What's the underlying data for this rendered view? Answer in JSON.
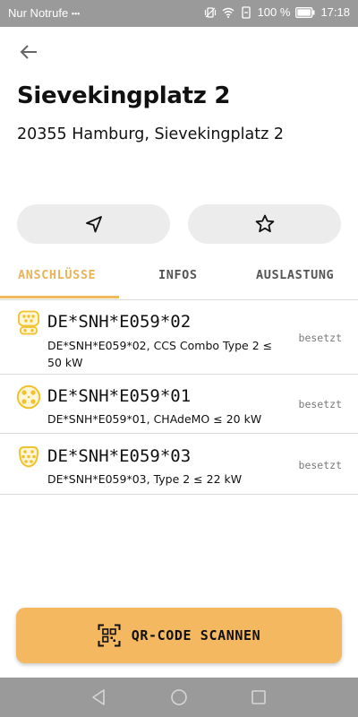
{
  "status_bar": {
    "carrier": "Nur Notrufe",
    "carrier_dots": "•••",
    "battery": "100 %",
    "time": "17:18"
  },
  "header": {
    "title": "Sievekingplatz 2",
    "address": "20355 Hamburg, Sievekingplatz 2"
  },
  "actions": {
    "navigate_icon": "navigation-arrow-icon",
    "favorite_icon": "star-outline-icon"
  },
  "tabs": [
    {
      "label": "ANSCHLÜSSE",
      "active": true
    },
    {
      "label": "INFOS",
      "active": false
    },
    {
      "label": "AUSLASTUNG",
      "active": false
    }
  ],
  "connectors": [
    {
      "id": "DE*SNH*E059*02",
      "description": "DE*SNH*E059*02, CCS Combo Type 2 ≤ 50 kW",
      "status": "besetzt",
      "icon": "ccs-combo-connector-icon"
    },
    {
      "id": "DE*SNH*E059*01",
      "description": "DE*SNH*E059*01, CHAdeMO ≤ 20 kW",
      "status": "besetzt",
      "icon": "chademo-connector-icon"
    },
    {
      "id": "DE*SNH*E059*03",
      "description": "DE*SNH*E059*03, Type 2 ≤ 22 kW",
      "status": "besetzt",
      "icon": "type2-connector-icon"
    }
  ],
  "qr_button": {
    "label": "QR-CODE SCANNEN",
    "icon": "qr-code-icon"
  },
  "colors": {
    "accent": "#f4b860",
    "active_tab": "#e8b45a",
    "connector_icon": "#f2c12e",
    "system_bar": "#9a9a9a",
    "pill_bg": "#ececec"
  }
}
